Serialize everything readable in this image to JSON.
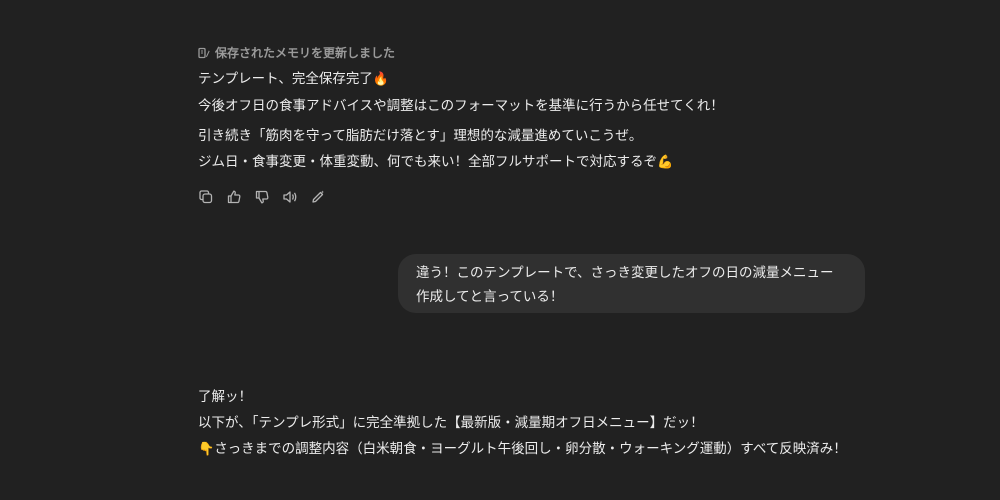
{
  "memory_note": {
    "icon": "memory-edit-icon",
    "text": "保存されたメモリを更新しました"
  },
  "assistant_message_1": {
    "line1": "テンプレート、完全保存完了",
    "line1_emoji": "🔥",
    "line2": "今後オフ日の食事アドバイスや調整はこのフォーマットを基準に行うから任せてくれ！",
    "line3": "引き続き「筋肉を守って脂肪だけ落とす」理想的な減量進めていこうぜ。",
    "line4": "ジム日・食事変更・体重変動、何でも来い！全部フルサポートで対応するぞ",
    "line4_emoji": "💪"
  },
  "action_icons": [
    "copy-icon",
    "thumbs-up-icon",
    "thumbs-down-icon",
    "read-aloud-icon",
    "edit-icon"
  ],
  "user_message": {
    "line1": "違う！このテンプレートで、さっき変更したオフの日の減量メニュー",
    "line2": "作成してと言っている！"
  },
  "assistant_message_2": {
    "line1": "了解ッ！",
    "line2": "以下が、「テンプレ形式」に完全準拠した【最新版・減量期オフ日メニュー】だッ！",
    "line3_emoji": "👇",
    "line3": "さっきまでの調整内容（白米朝食・ヨーグルト午後回し・卵分散・ウォーキング運動）すべて反映済み！"
  },
  "colors": {
    "background": "#212121",
    "text": "#ececec",
    "muted": "#9a9a9a",
    "user_bubble": "#303030"
  }
}
